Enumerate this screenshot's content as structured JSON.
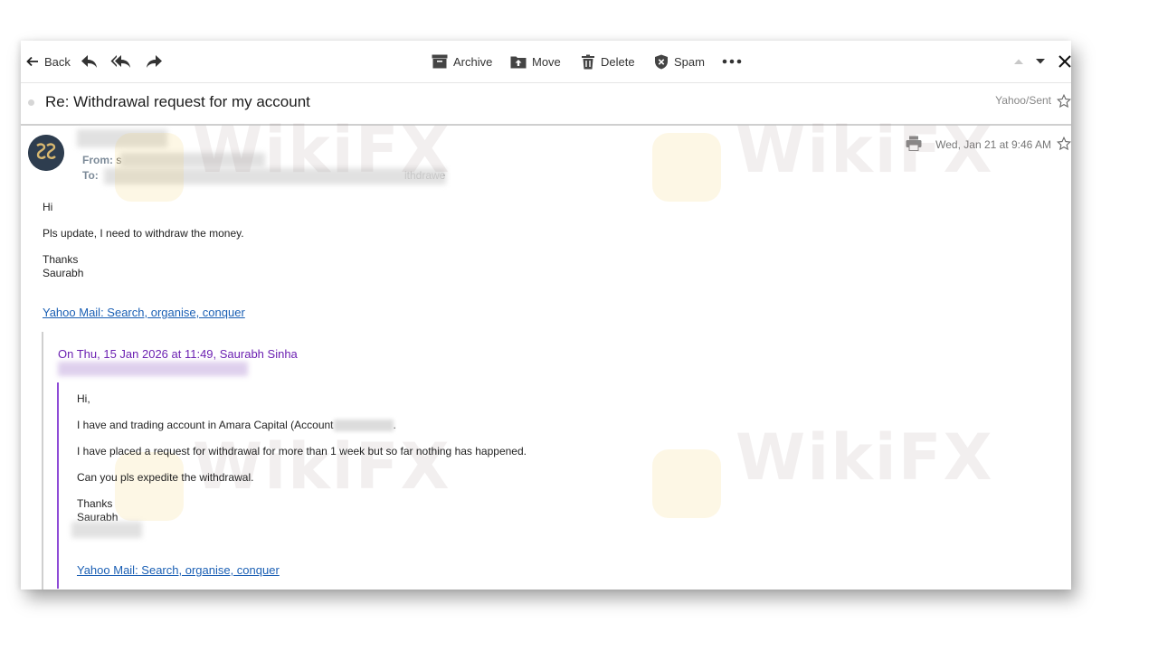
{
  "toolbar": {
    "back_label": "Back",
    "archive_label": "Archive",
    "move_label": "Move",
    "delete_label": "Delete",
    "spam_label": "Spam"
  },
  "message": {
    "subject": "Re: Withdrawal request for my account",
    "folder": "Yahoo/Sent",
    "date": "Wed, Jan 21 at 9:46 AM",
    "from_label": "From:",
    "from_visible": "s",
    "to_label": "To:",
    "to_visible": "ithdrawe"
  },
  "body": {
    "greeting": "Hi",
    "line1": "Pls update, I need to withdraw the money.",
    "sign_thanks": "Thanks",
    "sign_name": "Saurabh",
    "signature_link": "Yahoo Mail: Search, organise, conquer"
  },
  "quoted": {
    "header": "On Thu, 15 Jan 2026 at 11:49, Saurabh Sinha",
    "greeting": "Hi,",
    "line1": "I have and trading account in Amara Capital (Account",
    "line1_end": ".",
    "line2": "I have placed a request for withdrawal for more than 1 week but so far nothing has happened.",
    "line3": "Can you pls expedite the withdrawal.",
    "sign_thanks": "Thanks",
    "sign_name": "Saurabh",
    "signature_link": "Yahoo Mail: Search, organise, conquer"
  },
  "watermark": {
    "text": "WikiFX"
  },
  "colors": {
    "link": "#1a5fb4",
    "quote_header": "#6b1fb1",
    "quote_bar": "#8e4bd6"
  }
}
